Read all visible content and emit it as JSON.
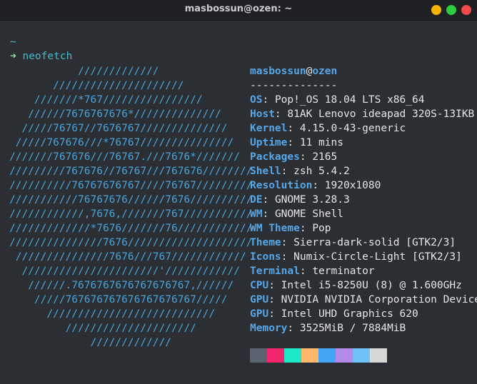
{
  "window": {
    "title": "masbossun@ozen: ~",
    "buttons": [
      {
        "name": "minimize",
        "color": "#f4b400"
      },
      {
        "name": "maximize",
        "color": "#2ecc40"
      },
      {
        "name": "close",
        "color": "#f04a4a"
      }
    ]
  },
  "terminal": {
    "cwd": "~",
    "prompt_symbol": "➜",
    "command": "neofetch",
    "logo_lines": [
      "           /////////////",
      "       /////////////////////",
      "    ///////*767////////////////",
      "   //////7676767676*//////////////",
      "  /////76767//7676767//////////////",
      " /////767676///*76767///////////////",
      "///////767676///76767.///7676*///////",
      "/////////767676//76767///767676////////",
      "//////////76767676767////76767/////////",
      "///////////76767676//////7676//////////",
      "////////////,7676,///////767///////////",
      "/////////////*7676///////76////////////",
      "///////////////7676////////////////////",
      " ///////////////7676///767////////////",
      "  //////////////////////'////////////",
      "   //////.7676767676767676767,//////",
      "    /////767676767676767676767/////",
      "      ///////////////////////////",
      "         /////////////////////",
      "             /////////////"
    ],
    "header": {
      "user": "masbossun",
      "at": "@",
      "host": "ozen"
    },
    "separator": "--------------",
    "info": [
      {
        "key": "OS",
        "value": "Pop!_OS 18.04 LTS x86_64"
      },
      {
        "key": "Host",
        "value": "81AK Lenovo ideapad 320S-13IKB"
      },
      {
        "key": "Kernel",
        "value": "4.15.0-43-generic"
      },
      {
        "key": "Uptime",
        "value": "11 mins"
      },
      {
        "key": "Packages",
        "value": "2165"
      },
      {
        "key": "Shell",
        "value": "zsh 5.4.2"
      },
      {
        "key": "Resolution",
        "value": "1920x1080"
      },
      {
        "key": "DE",
        "value": "GNOME 3.28.3"
      },
      {
        "key": "WM",
        "value": "GNOME Shell"
      },
      {
        "key": "WM Theme",
        "value": "Pop"
      },
      {
        "key": "Theme",
        "value": "Sierra-dark-solid [GTK2/3]"
      },
      {
        "key": "Icons",
        "value": "Numix-Circle-Light [GTK2/3]"
      },
      {
        "key": "Terminal",
        "value": "terminator"
      },
      {
        "key": "CPU",
        "value": "Intel i5-8250U (8) @ 1.600GHz"
      },
      {
        "key": "GPU",
        "value": "NVIDIA NVIDIA Corporation Device"
      },
      {
        "key": "GPU",
        "value": "Intel UHD Graphics 620"
      },
      {
        "key": "Memory",
        "value": "3525MiB / 7884MiB"
      }
    ],
    "palette": [
      "#5c6370",
      "#f2256d",
      "#1de9c7",
      "#ffb86c",
      "#42a5f5",
      "#b48ae8",
      "#6ec1f5",
      "#d8d8d8"
    ]
  }
}
